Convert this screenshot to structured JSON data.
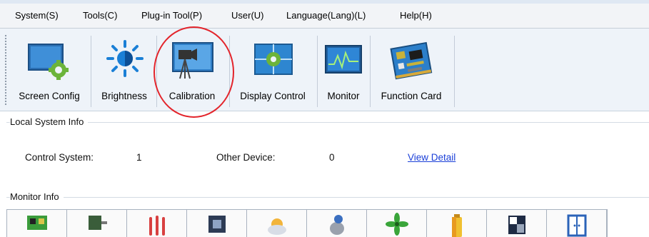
{
  "menu": [
    "System(S)",
    "Tools(C)",
    "Plug-in Tool(P)",
    "User(U)",
    "Language(Lang)(L)",
    "Help(H)"
  ],
  "toolbar": [
    {
      "label": "Screen Config",
      "icon": "screen-config-icon"
    },
    {
      "label": "Brightness",
      "icon": "brightness-icon"
    },
    {
      "label": "Calibration",
      "icon": "calibration-icon"
    },
    {
      "label": "Display Control",
      "icon": "display-control-icon"
    },
    {
      "label": "Monitor",
      "icon": "monitor-icon"
    },
    {
      "label": "Function Card",
      "icon": "function-card-icon"
    }
  ],
  "local_system": {
    "title": "Local System Info",
    "control_label": "Control System:",
    "control_value": "1",
    "other_label": "Other Device:",
    "other_value": "0",
    "view_detail": "View Detail"
  },
  "monitor_info": {
    "title": "Monitor Info",
    "icons": [
      "receiving-card-icon",
      "module-icon",
      "temperature-icon",
      "chip-icon",
      "weather-icon",
      "humidity-icon",
      "fan-icon",
      "battery-icon",
      "display-icon",
      "cabinet-door-icon"
    ]
  },
  "colors": {
    "highlight_circle": "#e3242b",
    "link": "#1a3fd8",
    "toolbar_bg": "#eef3f9"
  }
}
